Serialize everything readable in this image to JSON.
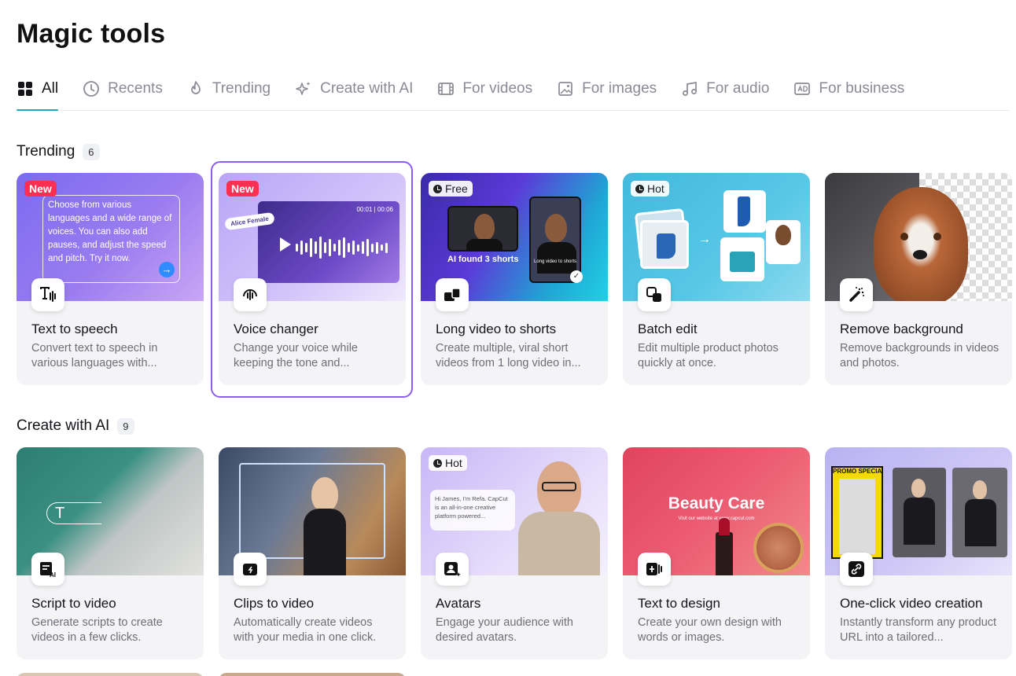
{
  "page": {
    "title": "Magic tools"
  },
  "tabs": [
    {
      "label": "All",
      "icon": "grid-icon",
      "active": true
    },
    {
      "label": "Recents",
      "icon": "clock-icon"
    },
    {
      "label": "Trending",
      "icon": "flame-icon"
    },
    {
      "label": "Create with AI",
      "icon": "sparkle-icon"
    },
    {
      "label": "For videos",
      "icon": "film-icon"
    },
    {
      "label": "For images",
      "icon": "image-icon"
    },
    {
      "label": "For audio",
      "icon": "music-note-icon"
    },
    {
      "label": "For business",
      "icon": "ad-icon"
    }
  ],
  "sections": [
    {
      "title": "Trending",
      "count": "6",
      "cards": [
        {
          "name": "Text to speech",
          "desc": "Convert text to speech in various languages with...",
          "badge": "New",
          "icon": "text-to-speech-icon",
          "preview_text": "Choose from various languages and a wide range of voices. You can also add pauses, and adjust the speed and pitch. Try it now."
        },
        {
          "name": "Voice changer",
          "desc": "Change your voice while keeping the tone and...",
          "badge": "New",
          "icon": "voice-changer-icon",
          "preview_label": "Alice Female",
          "preview_time": "00:01 | 00:06"
        },
        {
          "name": "Long video to shorts",
          "desc": "Create multiple, viral short videos from 1 long video in...",
          "badge": "Free",
          "icon": "long-to-shorts-icon",
          "preview_caption": "AI found 3 shorts",
          "preview_small": "Long video to shorts"
        },
        {
          "name": "Batch edit",
          "desc": "Edit multiple product photos quickly at once.",
          "badge": "Hot",
          "icon": "batch-edit-icon"
        },
        {
          "name": "Remove background",
          "desc": "Remove backgrounds in videos and photos.",
          "icon": "magic-wand-icon"
        }
      ]
    },
    {
      "title": "Create with AI",
      "count": "9",
      "cards": [
        {
          "name": "Script to video",
          "desc": "Generate scripts to create videos in a few clicks.",
          "icon": "script-ai-icon",
          "preview_text": "T"
        },
        {
          "name": "Clips to video",
          "desc": "Automatically create videos with your media in one click.",
          "icon": "clips-video-icon"
        },
        {
          "name": "Avatars",
          "desc": "Engage your audience with desired avatars.",
          "badge": "Hot",
          "icon": "avatar-icon",
          "preview_chat": "Hi James, I'm Refa. CapCut is an all-in-one creative platform powered..."
        },
        {
          "name": "Text to design",
          "desc": "Create your own design with words or images.",
          "icon": "text-design-icon",
          "preview_title": "Beauty Care",
          "preview_sub": "Visit our website at www.capcut.com"
        },
        {
          "name": "One-click video creation",
          "desc": "Instantly transform any product URL into a tailored...",
          "icon": "link-video-icon",
          "preview_text": "PROMO SPECIAL"
        }
      ]
    }
  ],
  "colors": {
    "accent": "#1aa9c3",
    "highlight": "#8b5cf6",
    "new_badge": "#ff2f52"
  }
}
